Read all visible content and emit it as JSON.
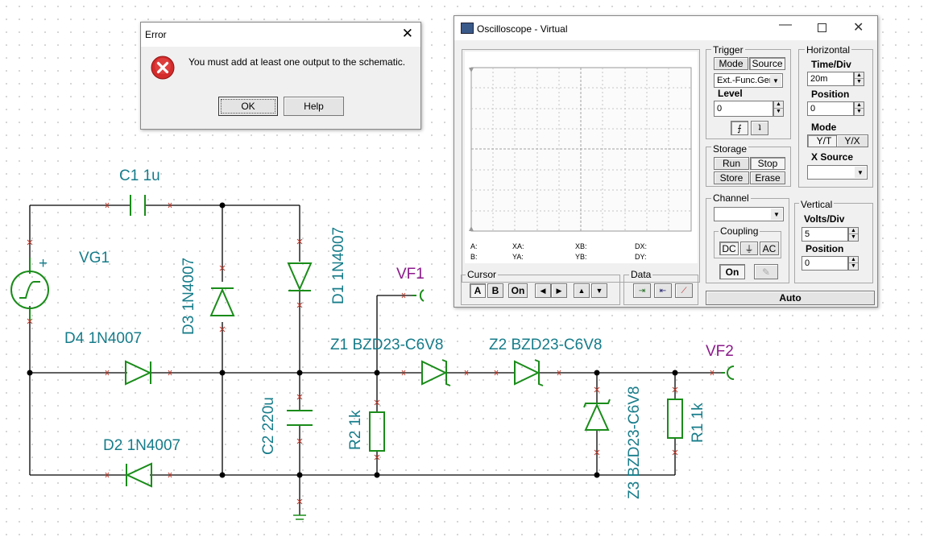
{
  "schematic": {
    "labels": {
      "c1": "C1 1u",
      "vg1": "VG1",
      "d3": "D3 1N4007",
      "d1": "D1 1N4007",
      "d4": "D4 1N4007",
      "d2": "D2 1N4007",
      "c2": "C2 220u",
      "r2": "R2 1k",
      "z1": "Z1 BZD23-C6V8",
      "z2": "Z2 BZD23-C6V8",
      "z3": "Z3 BZD23-C6V8",
      "r1": "R1 1k",
      "vf1": "VF1",
      "vf2": "VF2",
      "plus": "+"
    },
    "colors": {
      "wire": "#000000",
      "component": "#1a8c1a",
      "label": "#167c8a",
      "probe": "#8c1a8c",
      "pin": "#c0392b"
    }
  },
  "error_dialog": {
    "title": "Error",
    "message": "You must add at least one output to the schematic.",
    "ok_label": "OK",
    "help_label": "Help",
    "close_icon": "close-icon",
    "error_icon": "error-icon"
  },
  "oscilloscope": {
    "title": "Oscilloscope - Virtual",
    "readouts": {
      "a": "A:",
      "b": "B:",
      "xa": "XA:",
      "ya": "YA:",
      "xb": "XB:",
      "yb": "YB:",
      "dx": "DX:",
      "dy": "DY:"
    },
    "trigger": {
      "title": "Trigger",
      "mode_label": "Mode",
      "source_label": "Source",
      "source_value": "Ext.-Func.Gen",
      "level_label": "Level",
      "level_value": "0"
    },
    "horizontal": {
      "title": "Horizontal",
      "timediv_label": "Time/Div",
      "timediv_value": "20m",
      "position_label": "Position",
      "position_value": "0",
      "mode_label": "Mode",
      "yt_label": "Y/T",
      "yx_label": "Y/X",
      "xsource_label": "X Source",
      "xsource_value": ""
    },
    "storage": {
      "title": "Storage",
      "run": "Run",
      "stop": "Stop",
      "store": "Store",
      "erase": "Erase"
    },
    "channel": {
      "title": "Channel",
      "value": "",
      "coupling_label": "Coupling",
      "dc": "DC",
      "ac": "AC",
      "on": "On"
    },
    "vertical": {
      "title": "Vertical",
      "voltsdiv_label": "Volts/Div",
      "voltsdiv_value": "5",
      "position_label": "Position",
      "position_value": "0"
    },
    "cursor": {
      "title": "Cursor",
      "a": "A",
      "b": "B",
      "on": "On"
    },
    "data": {
      "title": "Data"
    },
    "auto_label": "Auto"
  }
}
